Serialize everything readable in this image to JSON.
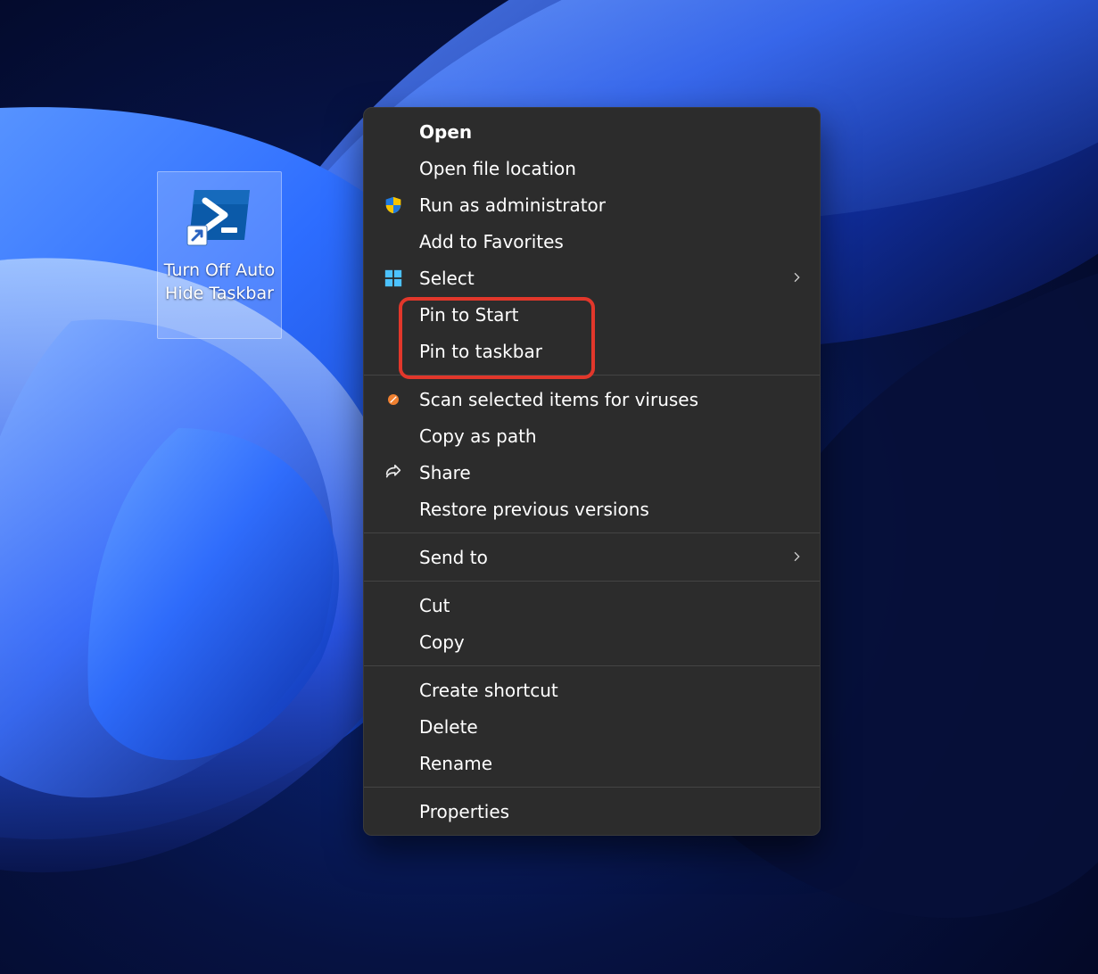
{
  "desktop": {
    "shortcut_label": "Turn Off Auto Hide Taskbar"
  },
  "context_menu": {
    "items": [
      {
        "label": "Open",
        "bold": true,
        "icon": null
      },
      {
        "label": "Open file location",
        "icon": null
      },
      {
        "label": "Run as administrator",
        "icon": "shield"
      },
      {
        "label": "Add to Favorites",
        "icon": null
      },
      {
        "label": "Select",
        "icon": "win-start",
        "submenu": true
      },
      {
        "label": "Pin to Start",
        "icon": null
      },
      {
        "label": "Pin to taskbar",
        "icon": null
      },
      {
        "sep": true
      },
      {
        "label": "Scan selected items for viruses",
        "icon": "av"
      },
      {
        "label": "Copy as path",
        "icon": null
      },
      {
        "label": "Share",
        "icon": "share"
      },
      {
        "label": "Restore previous versions",
        "icon": null
      },
      {
        "sep": true
      },
      {
        "label": "Send to",
        "icon": null,
        "submenu": true
      },
      {
        "sep": true
      },
      {
        "label": "Cut",
        "icon": null
      },
      {
        "label": "Copy",
        "icon": null
      },
      {
        "sep": true
      },
      {
        "label": "Create shortcut",
        "icon": null
      },
      {
        "label": "Delete",
        "icon": null
      },
      {
        "label": "Rename",
        "icon": null
      },
      {
        "sep": true
      },
      {
        "label": "Properties",
        "icon": null
      }
    ]
  },
  "highlight": {
    "around_labels": [
      "Pin to Start",
      "Pin to taskbar"
    ]
  },
  "colors": {
    "menu_bg": "#2c2c2c",
    "highlight": "#e2372b",
    "powershell": "#0b5aa9"
  }
}
